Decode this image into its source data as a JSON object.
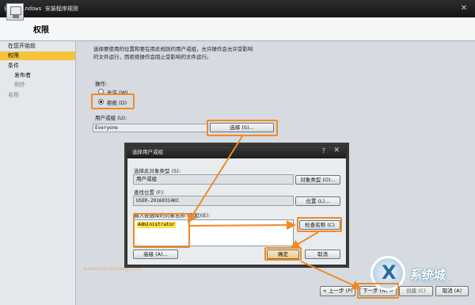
{
  "window": {
    "title": "创建 Windows 安装程序规则"
  },
  "header": {
    "title": "权限"
  },
  "nav": {
    "items": [
      {
        "label": "在您开始前",
        "state": "normal"
      },
      {
        "label": "权限",
        "state": "active"
      },
      {
        "label": "条件",
        "state": "normal"
      },
      {
        "label": "发布者",
        "state": "normal"
      },
      {
        "label": "例外",
        "state": "disabled"
      },
      {
        "label": "名称",
        "state": "disabled"
      }
    ]
  },
  "main": {
    "description_line1": "选择要使用的位置和要在用此规则的用户或组，允许操作会允许受影响",
    "description_line2": "的文件运行，而拒绝操作会阻止受影响的文件运行。",
    "action_label": "操作:",
    "allow_label": "允许 (W)",
    "deny_label": "拒绝 (D)",
    "selected_action": "deny",
    "usergroup_label": "用户或组 (U):",
    "usergroup_value": "Everyone",
    "select_button": "选择 (S)...",
    "faint_text": "www.xitongcheng.com"
  },
  "dialog": {
    "title": "选择用户或组",
    "help": "?",
    "object_type_label": "选择此对象类型 (S):",
    "object_type_value": "用户或组",
    "object_type_button": "对象类型 (O)...",
    "location_label": "查找位置 (F):",
    "location_value": "USER-20160314KC",
    "location_button": "位置 (L)...",
    "names_label": "输入要选择的对象名称 (例如)(E):",
    "names_value": "Administrator",
    "check_names_button": "检查名称 (C)",
    "advanced_button": "高级 (A)...",
    "ok_button": "确定",
    "cancel_button": "取消"
  },
  "footer": {
    "back_button": "< 上一步 (P)",
    "next_button": "下一步 (N) >",
    "create_button": "创建 (C)",
    "cancel_button": "取消 (A)"
  },
  "watermark": {
    "brand": "系统城",
    "sub": "XITONGCHENG.COM"
  },
  "colors": {
    "highlight": "#f08a24",
    "nav_active": "#f5c43a",
    "name_highlight": "#ffe24a"
  }
}
